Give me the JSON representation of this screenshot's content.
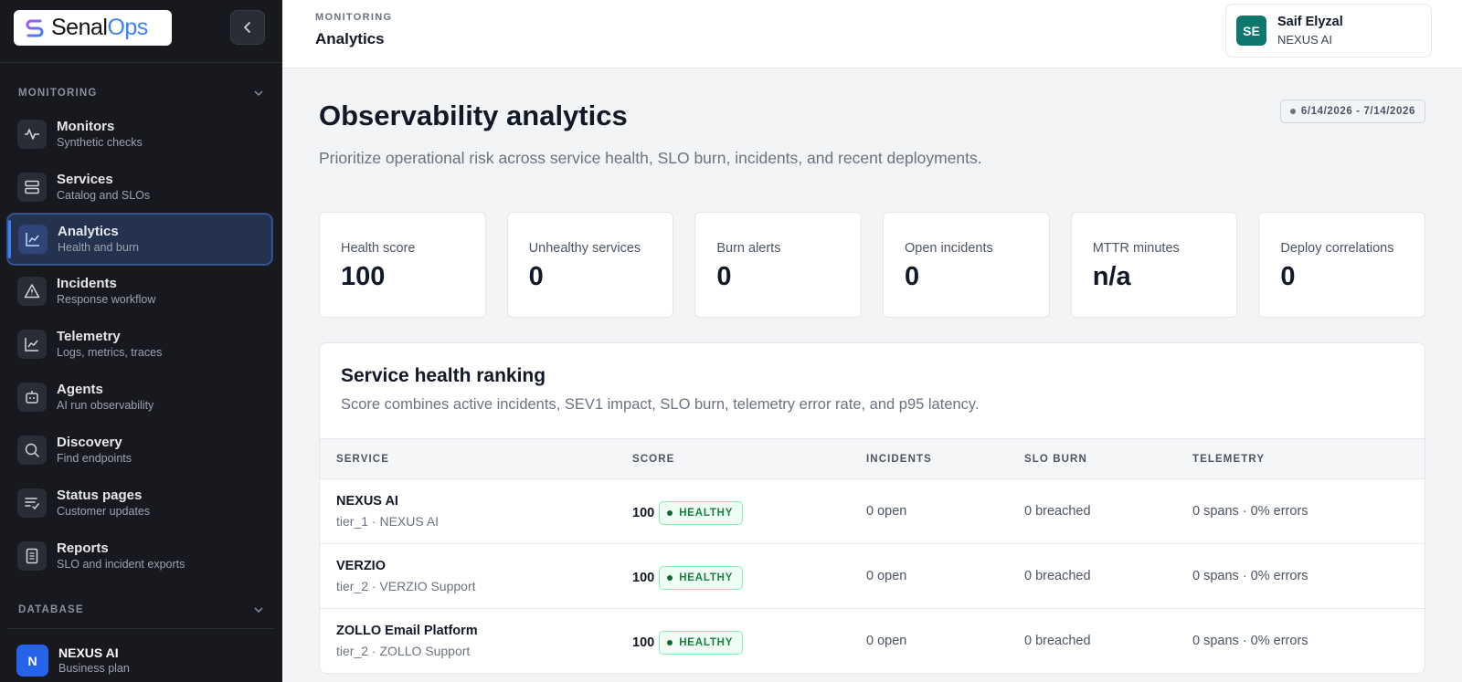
{
  "brand": {
    "name_a": "Senal",
    "name_b": "Ops"
  },
  "sidebar": {
    "monitoring_label": "MONITORING",
    "database_label": "DATABASE",
    "items": [
      {
        "title": "Monitors",
        "sub": "Synthetic checks",
        "icon": "activity-icon"
      },
      {
        "title": "Services",
        "sub": "Catalog and SLOs",
        "icon": "server-icon"
      },
      {
        "title": "Analytics",
        "sub": "Health and burn",
        "icon": "chart-line-icon"
      },
      {
        "title": "Incidents",
        "sub": "Response workflow",
        "icon": "alert-triangle-icon"
      },
      {
        "title": "Telemetry",
        "sub": "Logs, metrics, traces",
        "icon": "trend-icon"
      },
      {
        "title": "Agents",
        "sub": "AI run observability",
        "icon": "bot-icon"
      },
      {
        "title": "Discovery",
        "sub": "Find endpoints",
        "icon": "search-icon"
      },
      {
        "title": "Status pages",
        "sub": "Customer updates",
        "icon": "list-check-icon"
      },
      {
        "title": "Reports",
        "sub": "SLO and incident exports",
        "icon": "document-icon"
      }
    ],
    "org": {
      "initial": "N",
      "name": "NEXUS AI",
      "plan": "Business plan"
    }
  },
  "header": {
    "breadcrumb": "MONITORING",
    "title": "Analytics",
    "user": {
      "initials": "SE",
      "name": "Saif Elyzal",
      "org": "NEXUS AI"
    }
  },
  "main": {
    "title": "Observability analytics",
    "date_range": "6/14/2026 - 7/14/2026",
    "subtitle": "Prioritize operational risk across service health, SLO burn, incidents, and recent deployments.",
    "kpis": [
      {
        "label": "Health score",
        "value": "100"
      },
      {
        "label": "Unhealthy services",
        "value": "0"
      },
      {
        "label": "Burn alerts",
        "value": "0"
      },
      {
        "label": "Open incidents",
        "value": "0"
      },
      {
        "label": "MTTR minutes",
        "value": "n/a"
      },
      {
        "label": "Deploy correlations",
        "value": "0"
      }
    ],
    "ranking": {
      "title": "Service health ranking",
      "subtitle": "Score combines active incidents, SEV1 impact, SLO burn, telemetry error rate, and p95 latency.",
      "columns": [
        "SERVICE",
        "SCORE",
        "INCIDENTS",
        "SLO BURN",
        "TELEMETRY"
      ],
      "rows": [
        {
          "name": "NEXUS AI",
          "meta": "tier_1 · NEXUS AI",
          "score": "100",
          "status": "HEALTHY",
          "incidents": "0 open",
          "slo": "0 breached",
          "telemetry": "0 spans · 0% errors"
        },
        {
          "name": "VERZIO",
          "meta": "tier_2 · VERZIO Support",
          "score": "100",
          "status": "HEALTHY",
          "incidents": "0 open",
          "slo": "0 breached",
          "telemetry": "0 spans · 0% errors"
        },
        {
          "name": "ZOLLO Email Platform",
          "meta": "tier_2 · ZOLLO Support",
          "score": "100",
          "status": "HEALTHY",
          "incidents": "0 open",
          "slo": "0 breached",
          "telemetry": "0 spans · 0% errors"
        }
      ]
    }
  }
}
